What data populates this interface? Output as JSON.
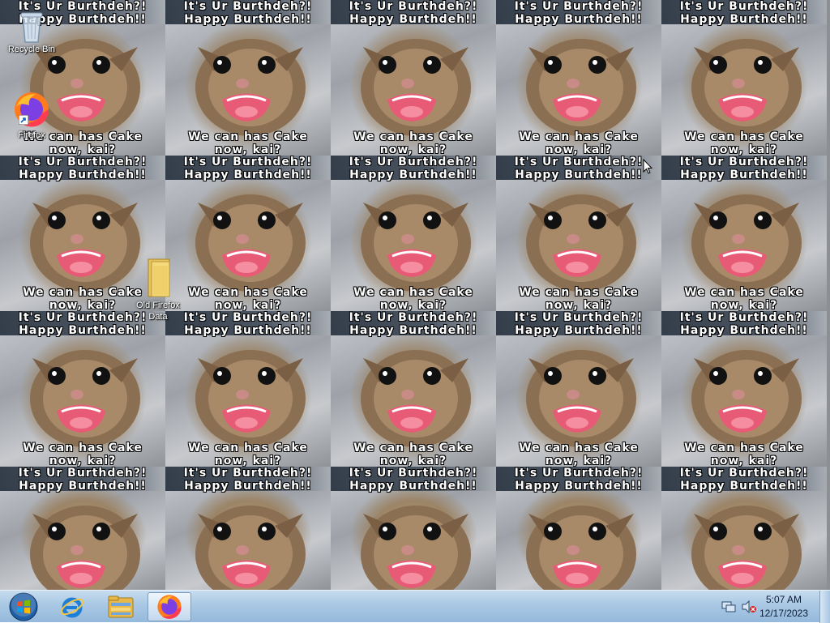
{
  "wallpaper": {
    "caption_top_line1": "It's Ur Burthdeh?!",
    "caption_top_line2": "Happy Burthdeh!!",
    "caption_bottom_line1": "We can has Cake",
    "caption_bottom_line2": "now, kai?"
  },
  "desktop": {
    "icons": [
      {
        "label": "Recycle Bin",
        "icon": "recycle-bin-icon"
      },
      {
        "label": "Firefox",
        "icon": "firefox-icon"
      },
      {
        "label": "Old Firefox Data",
        "icon": "folder-icon"
      }
    ]
  },
  "taskbar": {
    "start": {
      "icon": "windows-start-orb-icon"
    },
    "pinned": [
      {
        "name": "Internet Explorer",
        "icon": "internet-explorer-icon"
      },
      {
        "name": "Windows Explorer",
        "icon": "file-explorer-icon"
      },
      {
        "name": "Firefox",
        "icon": "firefox-icon",
        "active": true
      }
    ],
    "tray": {
      "icons": [
        "network-icon",
        "volume-muted-icon"
      ],
      "time": "5:07 AM",
      "date": "12/17/2023"
    }
  },
  "colors": {
    "taskbar": "#a9c8e4",
    "caption_text": "#ffffff",
    "caption_outline": "#000000"
  }
}
